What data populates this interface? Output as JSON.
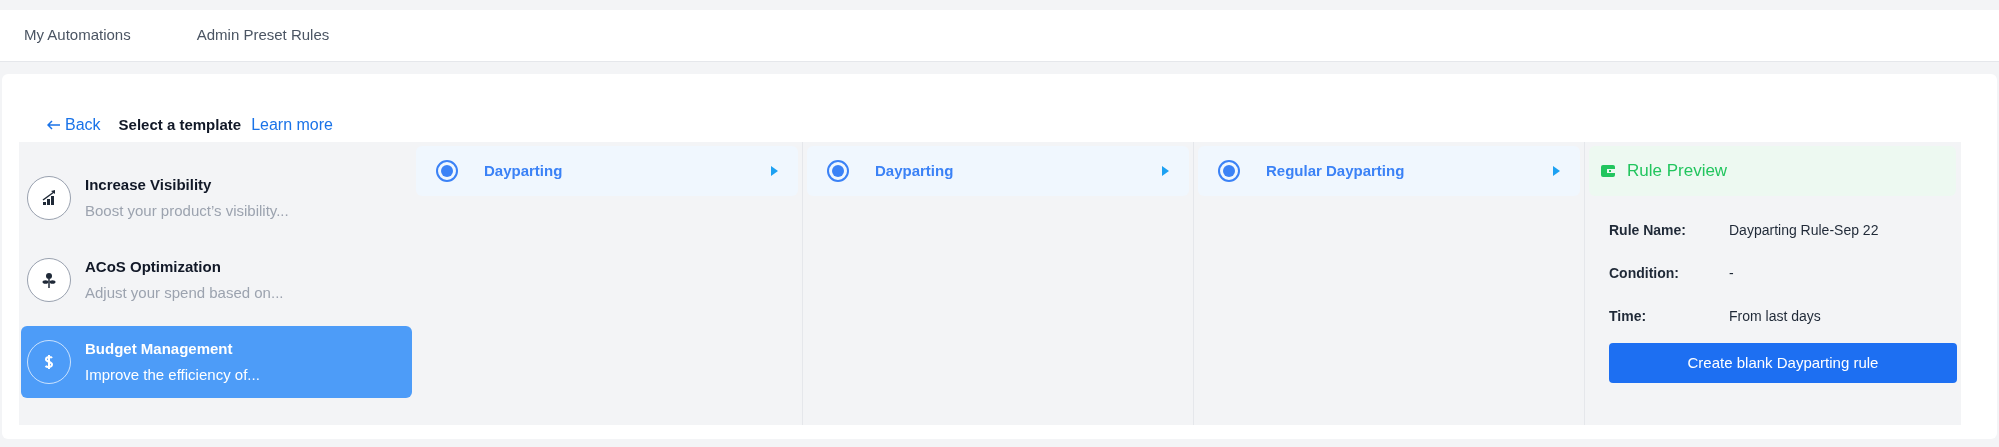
{
  "tabs": [
    {
      "label": "My Automations",
      "selected": false
    },
    {
      "label": "Admin Preset Rules",
      "selected": false
    }
  ],
  "header": {
    "back": "Back",
    "title": "Select a template",
    "link": "Learn more"
  },
  "templates": [
    {
      "kind": "chart",
      "title": "Increase Visibility",
      "subtitle": "Boost your product’s visibility...",
      "selected": false
    },
    {
      "kind": "plant",
      "title": "ACoS Optimization",
      "subtitle": "Adjust your spend based on...",
      "selected": false
    },
    {
      "kind": "dollar",
      "title": "Budget Management",
      "subtitle": "Improve the efficiency of...",
      "selected": true
    }
  ],
  "columns": [
    {
      "options": [
        {
          "label": "Dayparting",
          "selected": true
        }
      ]
    },
    {
      "options": [
        {
          "label": "Dayparting",
          "selected": true
        }
      ]
    },
    {
      "options": [
        {
          "label": "Regular Dayparting",
          "selected": true
        }
      ]
    }
  ],
  "preview": {
    "title": "Rule Preview",
    "fields": [
      {
        "label": "Rule Name:",
        "value": "Dayparting Rule-Sep 22"
      },
      {
        "label": "Condition:",
        "value": "-"
      },
      {
        "label": "Time:",
        "value": "From last days"
      }
    ],
    "button": "Create blank Dayparting rule"
  }
}
